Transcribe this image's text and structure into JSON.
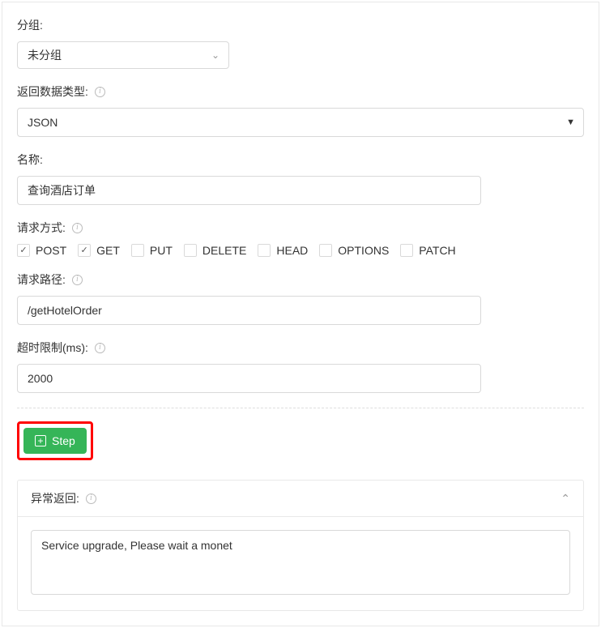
{
  "group": {
    "label": "分组:",
    "value": "未分组"
  },
  "responseType": {
    "label": "返回数据类型:",
    "value": "JSON"
  },
  "name": {
    "label": "名称:",
    "value": "查询酒店订单"
  },
  "method": {
    "label": "请求方式:",
    "options": [
      {
        "label": "POST",
        "checked": true
      },
      {
        "label": "GET",
        "checked": true
      },
      {
        "label": "PUT",
        "checked": false
      },
      {
        "label": "DELETE",
        "checked": false
      },
      {
        "label": "HEAD",
        "checked": false
      },
      {
        "label": "OPTIONS",
        "checked": false
      },
      {
        "label": "PATCH",
        "checked": false
      }
    ]
  },
  "path": {
    "label": "请求路径:",
    "value": "/getHotelOrder"
  },
  "timeout": {
    "label": "超时限制(ms):",
    "value": "2000"
  },
  "stepBtn": {
    "label": "Step"
  },
  "exception": {
    "title": "异常返回:",
    "value": "Service upgrade, Please wait a monet"
  }
}
